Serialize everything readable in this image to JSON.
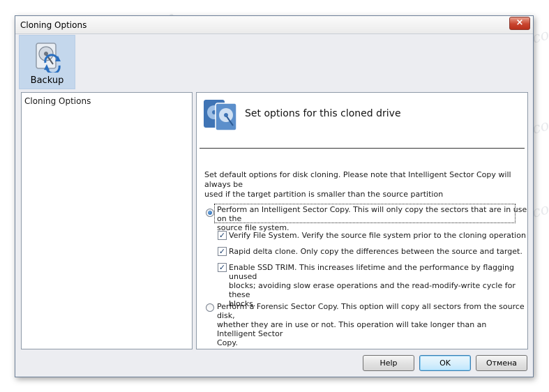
{
  "window": {
    "title": "Cloning Options",
    "close_label": "×"
  },
  "toolbar": {
    "backup_label": "Backup"
  },
  "left_panel": {
    "title": "Cloning Options"
  },
  "right_panel": {
    "header_title": "Set options for this cloned drive",
    "description_line1": "Set default options for disk cloning.  Please note that Intelligent Sector Copy will always be",
    "description_line2": "used if the target partition is smaller than the source partition",
    "options": {
      "intelligent": {
        "line1": "Perform an Intelligent Sector Copy.  This will only copy the sectors that are in use on the",
        "line2": "source file system.",
        "selected": true
      },
      "verify": {
        "label": "Verify File System.  Verify the source file system prior to the cloning operation",
        "checked": true
      },
      "rapid": {
        "label": "Rapid delta clone.  Only copy the differences between the source and target.",
        "checked": true
      },
      "trim": {
        "line1": "Enable SSD TRIM. This increases lifetime and the performance by flagging unused",
        "line2": "blocks; avoiding slow erase operations and the read-modify-write cycle for these",
        "line3": "blocks.",
        "checked": true
      },
      "forensic": {
        "line1": "Perform a Forensic Sector Copy. This option will copy all sectors from the source disk,",
        "line2": "whether they are in use or not.  This operation will take longer than an Intelligent Sector",
        "line3": "Copy.",
        "selected": false
      }
    }
  },
  "buttons": {
    "help": "Help",
    "ok": "OK",
    "cancel": "Отмена"
  },
  "watermark": "Soringpcrepair.com",
  "colors": {
    "accent": "#1b58a8",
    "selected_tool_bg": "#c4d7ec",
    "close_button": "#c9452f"
  },
  "icons": {
    "backup": "disk-clone-icon",
    "header": "cloned-drive-icon"
  }
}
